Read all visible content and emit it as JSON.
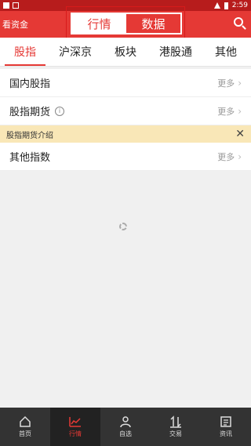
{
  "statusbar": {
    "time": "2:59"
  },
  "header": {
    "left_text": "看资金",
    "segments": [
      "行情",
      "数据"
    ]
  },
  "tabs": [
    "股指",
    "沪深京",
    "板块",
    "港股通",
    "其他"
  ],
  "rows": [
    {
      "label": "国内股指",
      "more": "更多"
    },
    {
      "label": "股指期货",
      "more": "更多"
    },
    {
      "label": "其他指数",
      "more": "更多"
    }
  ],
  "banner": {
    "text": "股指期货介绍"
  },
  "bottom_nav": [
    "首页",
    "行情",
    "自选",
    "交易",
    "资讯"
  ]
}
